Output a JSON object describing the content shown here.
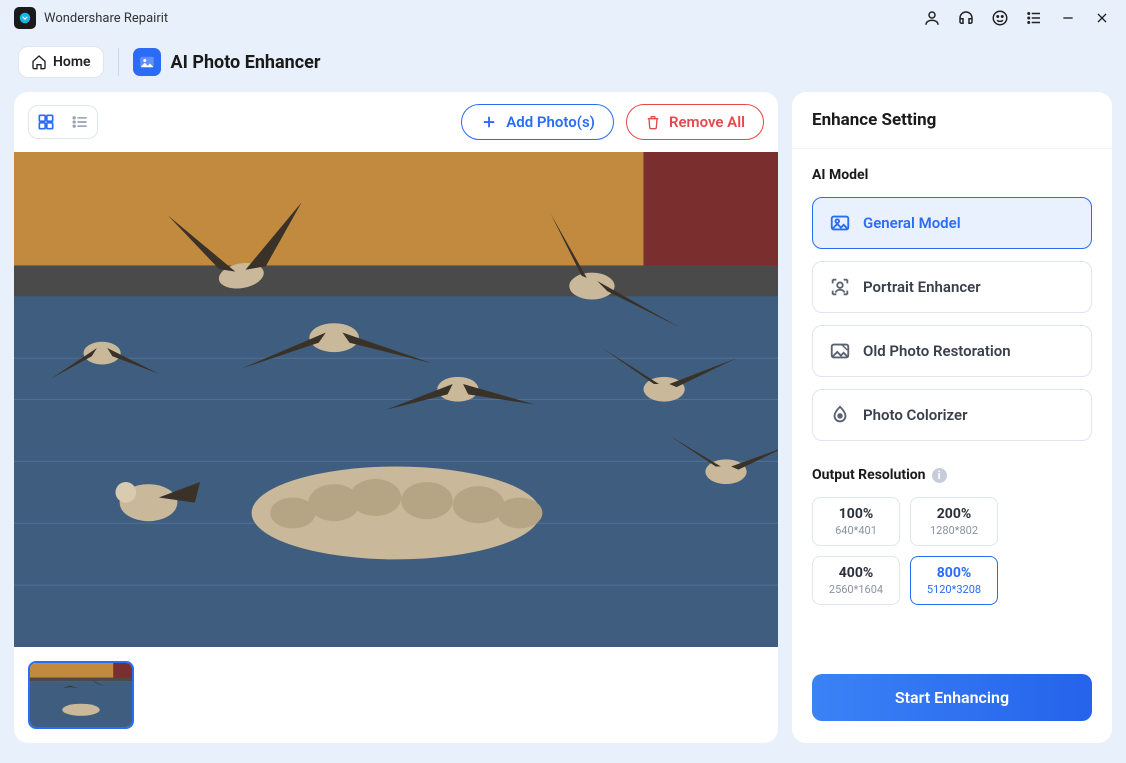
{
  "app": {
    "title": "Wondershare Repairit"
  },
  "nav": {
    "home_label": "Home",
    "module_title": "AI Photo Enhancer"
  },
  "toolbar": {
    "add_label": "Add Photo(s)",
    "remove_label": "Remove All"
  },
  "panel": {
    "header": "Enhance Setting",
    "ai_model_label": "AI Model",
    "models": [
      {
        "label": "General Model"
      },
      {
        "label": "Portrait Enhancer"
      },
      {
        "label": "Old Photo Restoration"
      },
      {
        "label": "Photo Colorizer"
      }
    ],
    "output_res_label": "Output Resolution",
    "resolutions": [
      {
        "pct": "100%",
        "dim": "640*401"
      },
      {
        "pct": "200%",
        "dim": "1280*802"
      },
      {
        "pct": "400%",
        "dim": "2560*1604"
      },
      {
        "pct": "800%",
        "dim": "5120*3208"
      }
    ],
    "start_label": "Start Enhancing"
  }
}
